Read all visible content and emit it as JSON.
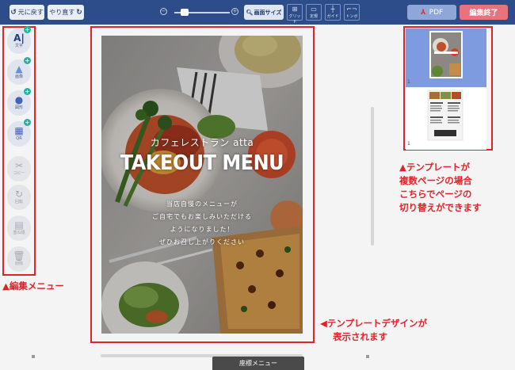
{
  "toolbar": {
    "undo_label": "元に戻す",
    "redo_label": "やり直す",
    "fit_label": "画面サイズ",
    "grid_label": "グリッド",
    "ruler_label": "定規",
    "guide_label": "ガイド",
    "trim_label": "トンボ",
    "pdf_label": "PDF",
    "finish_label": "編集終了"
  },
  "tools": [
    {
      "id": "text",
      "glyph": "A|",
      "label": "文字",
      "has_plus": true
    },
    {
      "id": "image",
      "glyph": "▲",
      "label": "画像",
      "has_plus": true
    },
    {
      "id": "shape",
      "glyph": "●",
      "label": "図形",
      "has_plus": true
    },
    {
      "id": "qr",
      "glyph": "▦",
      "label": "QR",
      "has_plus": true
    },
    {
      "id": "copy",
      "glyph": "✂",
      "label": "コピー",
      "has_plus": false
    },
    {
      "id": "rotate",
      "glyph": "↻",
      "label": "回転",
      "has_plus": false
    },
    {
      "id": "order",
      "glyph": "▤",
      "label": "重ね順",
      "has_plus": false
    },
    {
      "id": "delete",
      "glyph": "🗑",
      "label": "削除",
      "has_plus": false
    }
  ],
  "canvas": {
    "restaurant_name": "カフェレストラン atta",
    "headline": "TAKEOUT MENU",
    "lines": [
      "当店自慢のメニューが",
      "ご自宅でもお楽しみいただける",
      "ようになりました！",
      "ぜひお召し上がりください"
    ]
  },
  "pages": [
    {
      "number": "1",
      "active": true
    },
    {
      "number": "1",
      "active": false
    }
  ],
  "bottom_tab": "座標メニュー",
  "annotations": {
    "edit_menu": "▲編集メニュー",
    "template_design_1": "◀テンプレートデザインが",
    "template_design_2": "表示されます",
    "pages_1": "▲テンプレートが",
    "pages_2": "複数ページの場合",
    "pages_3": "こちらでページの",
    "pages_4": "切り替えができます"
  }
}
